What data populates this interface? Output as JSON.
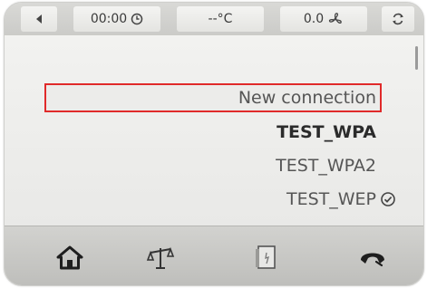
{
  "status_bar": {
    "time": "00:00",
    "temperature": "--°C",
    "wind": "0.0"
  },
  "connections": {
    "items": [
      {
        "label": "New connection",
        "selected": true
      },
      {
        "label": "TEST_WPA",
        "bold": true
      },
      {
        "label": "TEST_WPA2"
      },
      {
        "label": "TEST_WEP",
        "connected": true
      }
    ]
  },
  "bottom_nav": {
    "icons": [
      "home-icon",
      "scale-icon",
      "phone-card-icon",
      "hook-icon"
    ]
  },
  "colors": {
    "selection_border": "#e02a2a"
  }
}
